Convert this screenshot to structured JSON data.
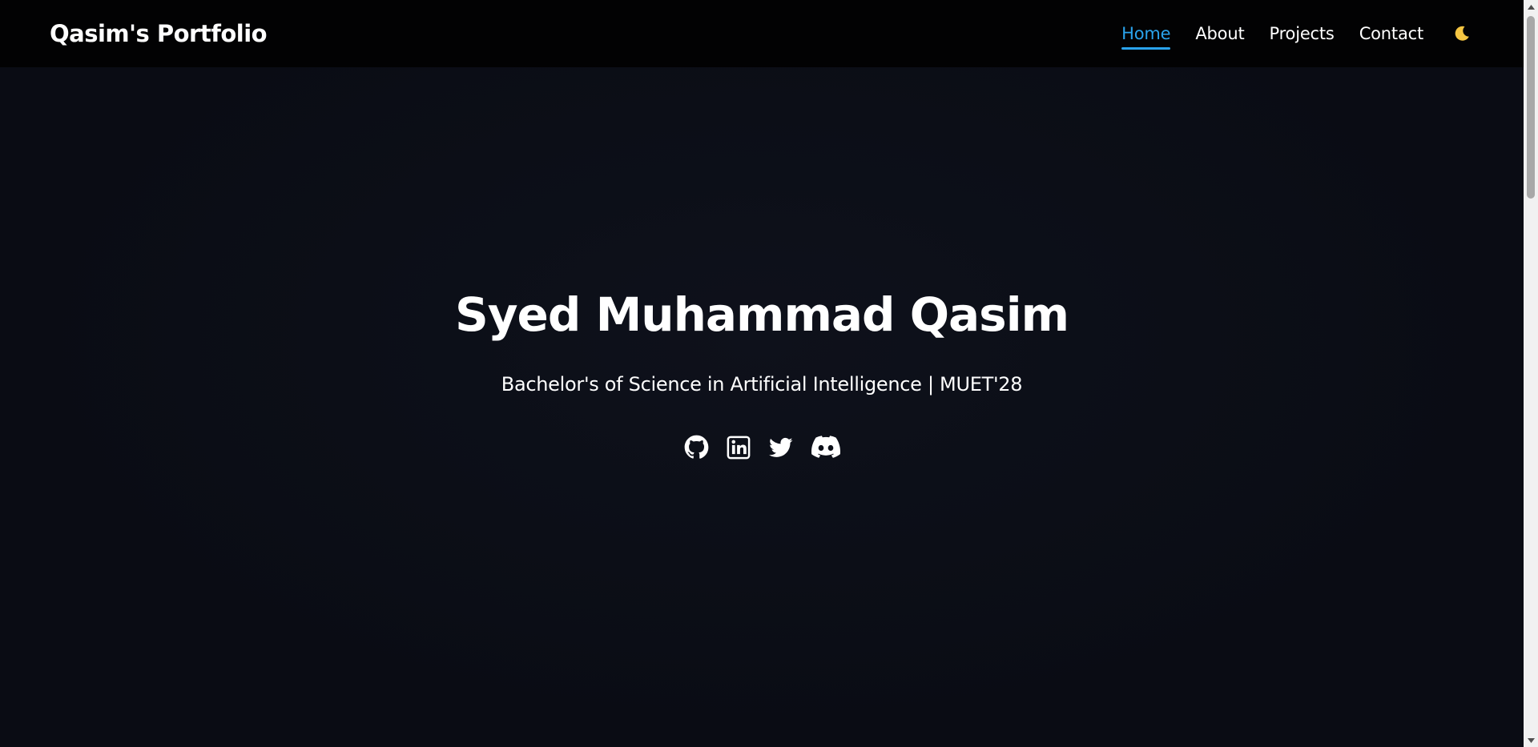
{
  "navbar": {
    "brand": "Qasim's Portfolio",
    "links": [
      {
        "label": "Home",
        "active": true
      },
      {
        "label": "About",
        "active": false
      },
      {
        "label": "Projects",
        "active": false
      },
      {
        "label": "Contact",
        "active": false
      }
    ],
    "theme_toggle_icon": "moon-icon"
  },
  "hero": {
    "title": "Syed Muhammad Qasim",
    "subtitle": "Bachelor's of Science in Artificial Intelligence | MUET'28",
    "socials": [
      {
        "icon": "github-icon"
      },
      {
        "icon": "linkedin-icon"
      },
      {
        "icon": "twitter-icon"
      },
      {
        "icon": "discord-icon"
      }
    ]
  },
  "colors": {
    "accent": "#2aa3ec",
    "navbar_bg": "#020203",
    "page_bg": "#0a0c14",
    "moon": "#f5c542"
  }
}
